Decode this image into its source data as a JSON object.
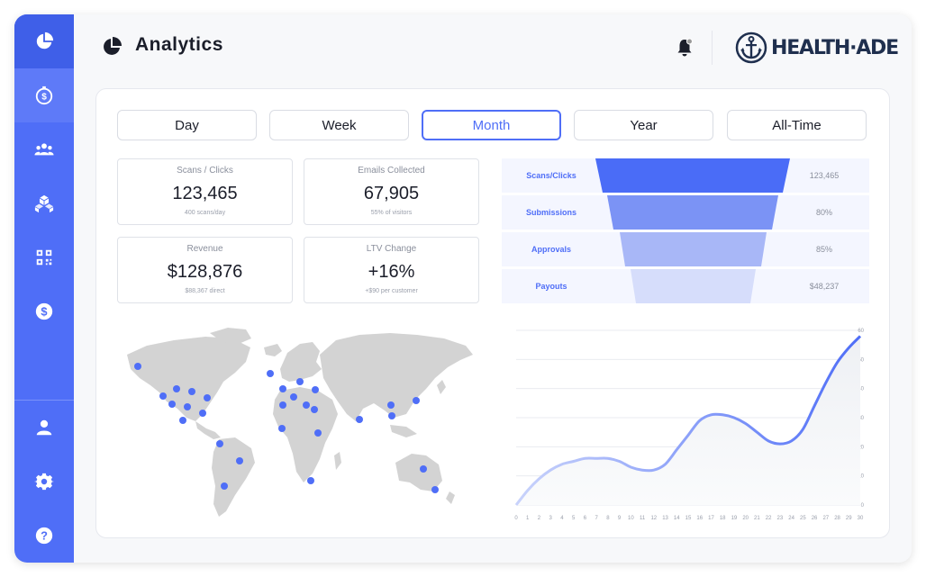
{
  "header": {
    "title": "Analytics",
    "brand": "HEALTH·ADE",
    "notifications": "bell-icon"
  },
  "sidebar": {
    "items": [
      {
        "icon": "pie-chart-icon",
        "active": true
      },
      {
        "icon": "coin-timer-icon",
        "current": true
      },
      {
        "icon": "users-icon"
      },
      {
        "icon": "boxes-icon"
      },
      {
        "icon": "qr-code-icon"
      },
      {
        "icon": "dollar-icon"
      }
    ],
    "bottom_items": [
      {
        "icon": "user-icon"
      },
      {
        "icon": "gear-icon"
      },
      {
        "icon": "help-icon"
      }
    ]
  },
  "tabs": [
    "Day",
    "Week",
    "Month",
    "Year",
    "All-Time"
  ],
  "selected_tab": "Month",
  "stats": [
    {
      "label": "Scans / Clicks",
      "value": "123,465",
      "sub": "400 scans/day"
    },
    {
      "label": "Emails Collected",
      "value": "67,905",
      "sub": "55% of visitors"
    },
    {
      "label": "Revenue",
      "value": "$128,876",
      "sub": "$88,367 direct"
    },
    {
      "label": "LTV Change",
      "value": "+16%",
      "sub": "+$90 per customer"
    }
  ],
  "funnel": [
    {
      "label": "Scans/Clicks",
      "value": "123,465",
      "color": "#4a6cf7"
    },
    {
      "label": "Submissions",
      "value": "80%",
      "color": "#7b93f5"
    },
    {
      "label": "Approvals",
      "value": "85%",
      "color": "#a8b7f7"
    },
    {
      "label": "Payouts",
      "value": "$48,237",
      "color": "#d6ddfb"
    }
  ],
  "colors": {
    "accent": "#4f6ef7",
    "map_land": "#d3d3d3",
    "dot": "#4f6ef7"
  },
  "chart_data": {
    "type": "line",
    "x": [
      0,
      1,
      2,
      3,
      4,
      5,
      6,
      7,
      8,
      9,
      10,
      11,
      12,
      13,
      14,
      15,
      16,
      17,
      18,
      19,
      20,
      21,
      22,
      23,
      24,
      25,
      26,
      27,
      28,
      29,
      30
    ],
    "y": [
      0,
      5,
      9,
      12,
      14,
      15,
      16,
      16,
      16,
      15,
      13,
      12,
      12,
      14,
      19,
      24,
      29,
      31,
      31,
      30,
      28,
      25,
      22,
      21,
      22,
      26,
      34,
      42,
      49,
      54,
      58
    ],
    "xlabel": "",
    "ylabel": "",
    "xlim": [
      0,
      30
    ],
    "ylim": [
      0,
      60
    ],
    "yticks": [
      0,
      10,
      20,
      30,
      40,
      50,
      60
    ],
    "grid": true
  }
}
